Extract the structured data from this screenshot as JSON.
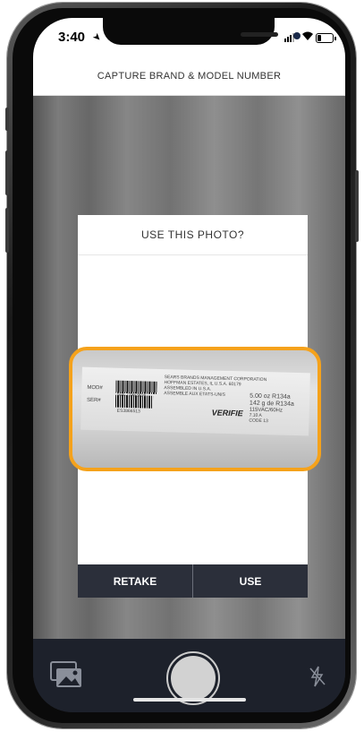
{
  "status_bar": {
    "time": "3:40",
    "icons": [
      "location-arrow-icon",
      "signal-icon",
      "wifi-icon",
      "battery-icon"
    ]
  },
  "header": {
    "title": "CAPTURE BRAND & MODEL NUMBER"
  },
  "modal": {
    "title": "USE THIS PHOTO?",
    "photo": {
      "accent_color": "#f5a21b",
      "label_lines": [
        "SEARS BRANDS MANAGEMENT CORPORATION",
        "HOFFMAN ESTATES, IL U.S.A. 60179",
        "ASSEMBLED IN U.S.A.",
        "ASSEMBLE AUX ETATS-UNIS"
      ],
      "model_label": "MOD#",
      "serial_label": "SER#",
      "model_number": "596.72963816",
      "serial_number": "ES3866513",
      "refrigerant_lines": [
        "5.00 oz R134a",
        "142 g de R134a",
        "115VAC/60Hz",
        "7.10 A",
        "CODE 13"
      ],
      "certification": "VERIFIE"
    },
    "retake_label": "RETAKE",
    "use_label": "USE"
  },
  "bottom_bar": {
    "icons": [
      "photo-gallery-icon",
      "shutter-button",
      "flash-off-icon"
    ]
  },
  "colors": {
    "accent": "#f5a21b",
    "footer": "#2b2f3a",
    "bottom_bar": "#1d212b"
  }
}
